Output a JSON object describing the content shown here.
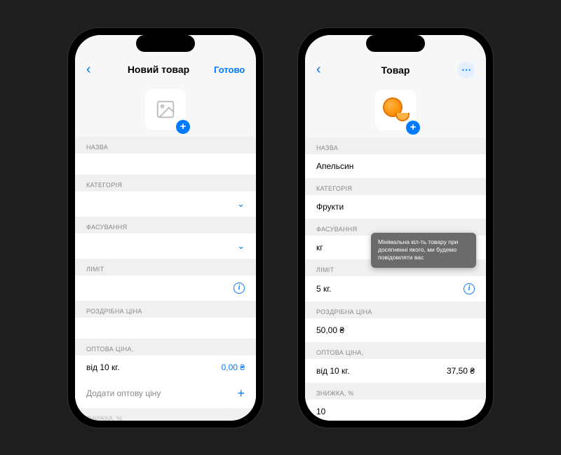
{
  "left": {
    "title": "Новий товар",
    "done": "Готово",
    "labels": {
      "name": "НАЗВА",
      "category": "КАТЕГОРІЯ",
      "packaging": "ФАСУВАННЯ",
      "limit": "ЛІМІТ",
      "retail": "РОЗДРІБНА ЦІНА",
      "wholesale": "ОПТОВА ЦІНА,",
      "discount_cut": "ЗНИЖКА, %"
    },
    "wholesale_from": "від 10 кг.",
    "wholesale_price": "0,00 ₴",
    "add_wholesale": "Додати оптову ціну"
  },
  "right": {
    "title": "Товар",
    "labels": {
      "name": "НАЗВА",
      "category": "КАТЕГОРІЯ",
      "packaging": "ФАСУВАННЯ",
      "limit": "ЛІМІТ",
      "retail": "РОЗДРІБНА ЦІНА",
      "wholesale": "ОПТОВА ЦІНА,",
      "discount": "ЗНИЖКА, %"
    },
    "values": {
      "name": "Апельсин",
      "category": "Фрукти",
      "packaging": "кг",
      "limit": "5 кг.",
      "retail": "50,00 ₴",
      "wholesale_from": "від 10 кг.",
      "wholesale_price": "37,50 ₴",
      "discount": "10"
    },
    "tooltip": "Мінімальна кіл-ть товару при досягненні якого, ми будемо повідомляти вас"
  }
}
